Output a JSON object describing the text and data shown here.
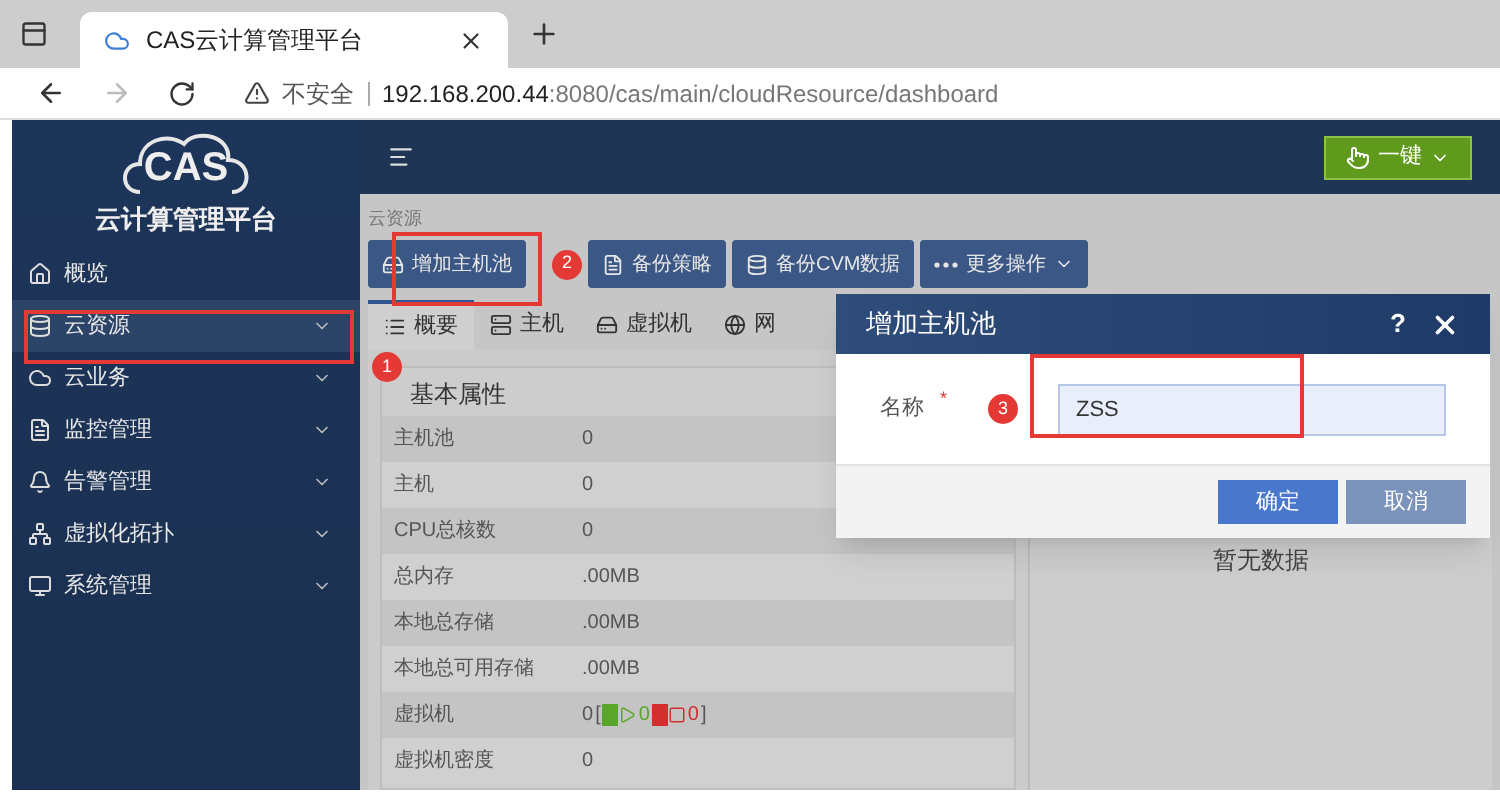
{
  "browser": {
    "tab_title": "CAS云计算管理平台",
    "security": "不安全",
    "url_host": "192.168.200.44",
    "url_rest": ":8080/cas/main/cloudResource/dashboard"
  },
  "sidebar": {
    "logo": "CAS",
    "platform": "云计算管理平台",
    "items": [
      {
        "label": "概览",
        "selected": false,
        "expandable": false
      },
      {
        "label": "云资源",
        "selected": true,
        "expandable": true
      },
      {
        "label": "云业务",
        "selected": false,
        "expandable": true
      },
      {
        "label": "监控管理",
        "selected": false,
        "expandable": true
      },
      {
        "label": "告警管理",
        "selected": false,
        "expandable": true
      },
      {
        "label": "虚拟化拓扑",
        "selected": false,
        "expandable": true
      },
      {
        "label": "系统管理",
        "selected": false,
        "expandable": true
      }
    ]
  },
  "topbar": {
    "one_key": "一键"
  },
  "breadcrumb": "云资源",
  "toolbar": [
    {
      "label": "增加主机池",
      "kind": "action"
    },
    {
      "label": "备份策略",
      "kind": "action"
    },
    {
      "label": "备份CVM数据",
      "kind": "action"
    },
    {
      "label": "更多操作",
      "kind": "menu"
    }
  ],
  "tabs": [
    {
      "label": "概要",
      "selected": true
    },
    {
      "label": "主机",
      "selected": false
    },
    {
      "label": "虚拟机",
      "selected": false
    },
    {
      "label": "网",
      "selected": false
    }
  ],
  "properties": {
    "title": "基本属性",
    "rows": [
      {
        "kind": "text",
        "name": "主机池",
        "value": "0"
      },
      {
        "kind": "text",
        "name": "主机",
        "value": "0"
      },
      {
        "kind": "text",
        "name": "CPU总核数",
        "value": "0"
      },
      {
        "kind": "text",
        "name": "总内存",
        "value": ".00MB"
      },
      {
        "kind": "text",
        "name": "本地总存储",
        "value": ".00MB"
      },
      {
        "kind": "text",
        "name": "本地总可用存储",
        "value": ".00MB"
      },
      {
        "kind": "vm",
        "name": "虚拟机",
        "value": "0",
        "open": "[",
        "running": "0",
        "stopped": "0",
        "close": "]"
      },
      {
        "kind": "text",
        "name": "虚拟机密度",
        "value": "0"
      }
    ]
  },
  "side_panel": {
    "empty": "暂无数据"
  },
  "dialog": {
    "title": "增加主机池",
    "help": "?",
    "fields": [
      {
        "label": "名称",
        "required_mark": "*",
        "value": "ZSS"
      }
    ],
    "buttons": [
      {
        "label": "确定",
        "kind": "primary"
      },
      {
        "label": "取消",
        "kind": "secondary"
      }
    ]
  },
  "annotations": [
    "1",
    "2",
    "3"
  ]
}
